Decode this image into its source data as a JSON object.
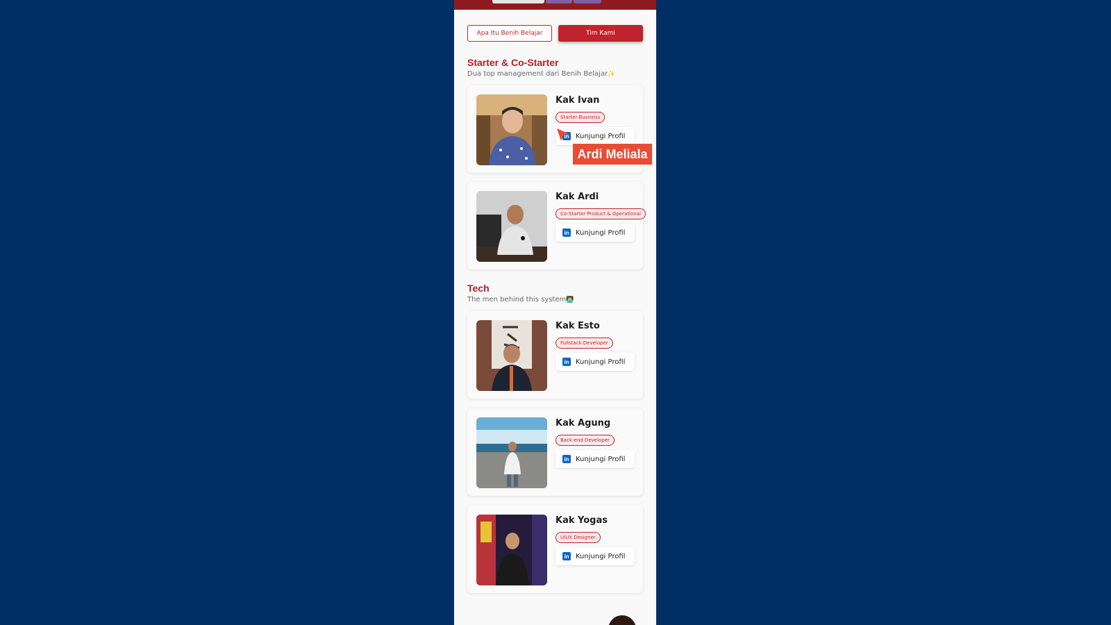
{
  "tabs": {
    "about": "Apa Itu Benih Belajar",
    "team": "Tim Kami"
  },
  "sections": [
    {
      "title": "Starter & Co-Starter",
      "subtitle": "Dua top management dari Benih Belajar",
      "subtitle_emoji": "✨",
      "members": [
        {
          "name": "Kak Ivan",
          "role": "Starter Business",
          "button": "Kunjungi Profil"
        },
        {
          "name": "Kak Ardi",
          "role": "Co-Starter Product & Operational",
          "button": "Kunjungi Profil"
        }
      ]
    },
    {
      "title": "Tech",
      "subtitle": "The men behind this system",
      "subtitle_emoji": "👨‍💻",
      "members": [
        {
          "name": "Kak Esto",
          "role": "Fullstack Developer",
          "button": "Kunjungi Profil"
        },
        {
          "name": "Kak Agung",
          "role": "Back-end Developer",
          "button": "Kunjungi Profil"
        },
        {
          "name": "Kak Yogas",
          "role": "UIUX Designer",
          "button": "Kunjungi Profil"
        }
      ]
    }
  ],
  "cursor_label": "Ardi Meliala",
  "linkedin_icon_text": "in",
  "colors": {
    "background": "#002f66",
    "accent": "#c0232d",
    "heading": "#b71c24",
    "cursor": "#ea4b35",
    "linkedin": "#0a66c2"
  }
}
